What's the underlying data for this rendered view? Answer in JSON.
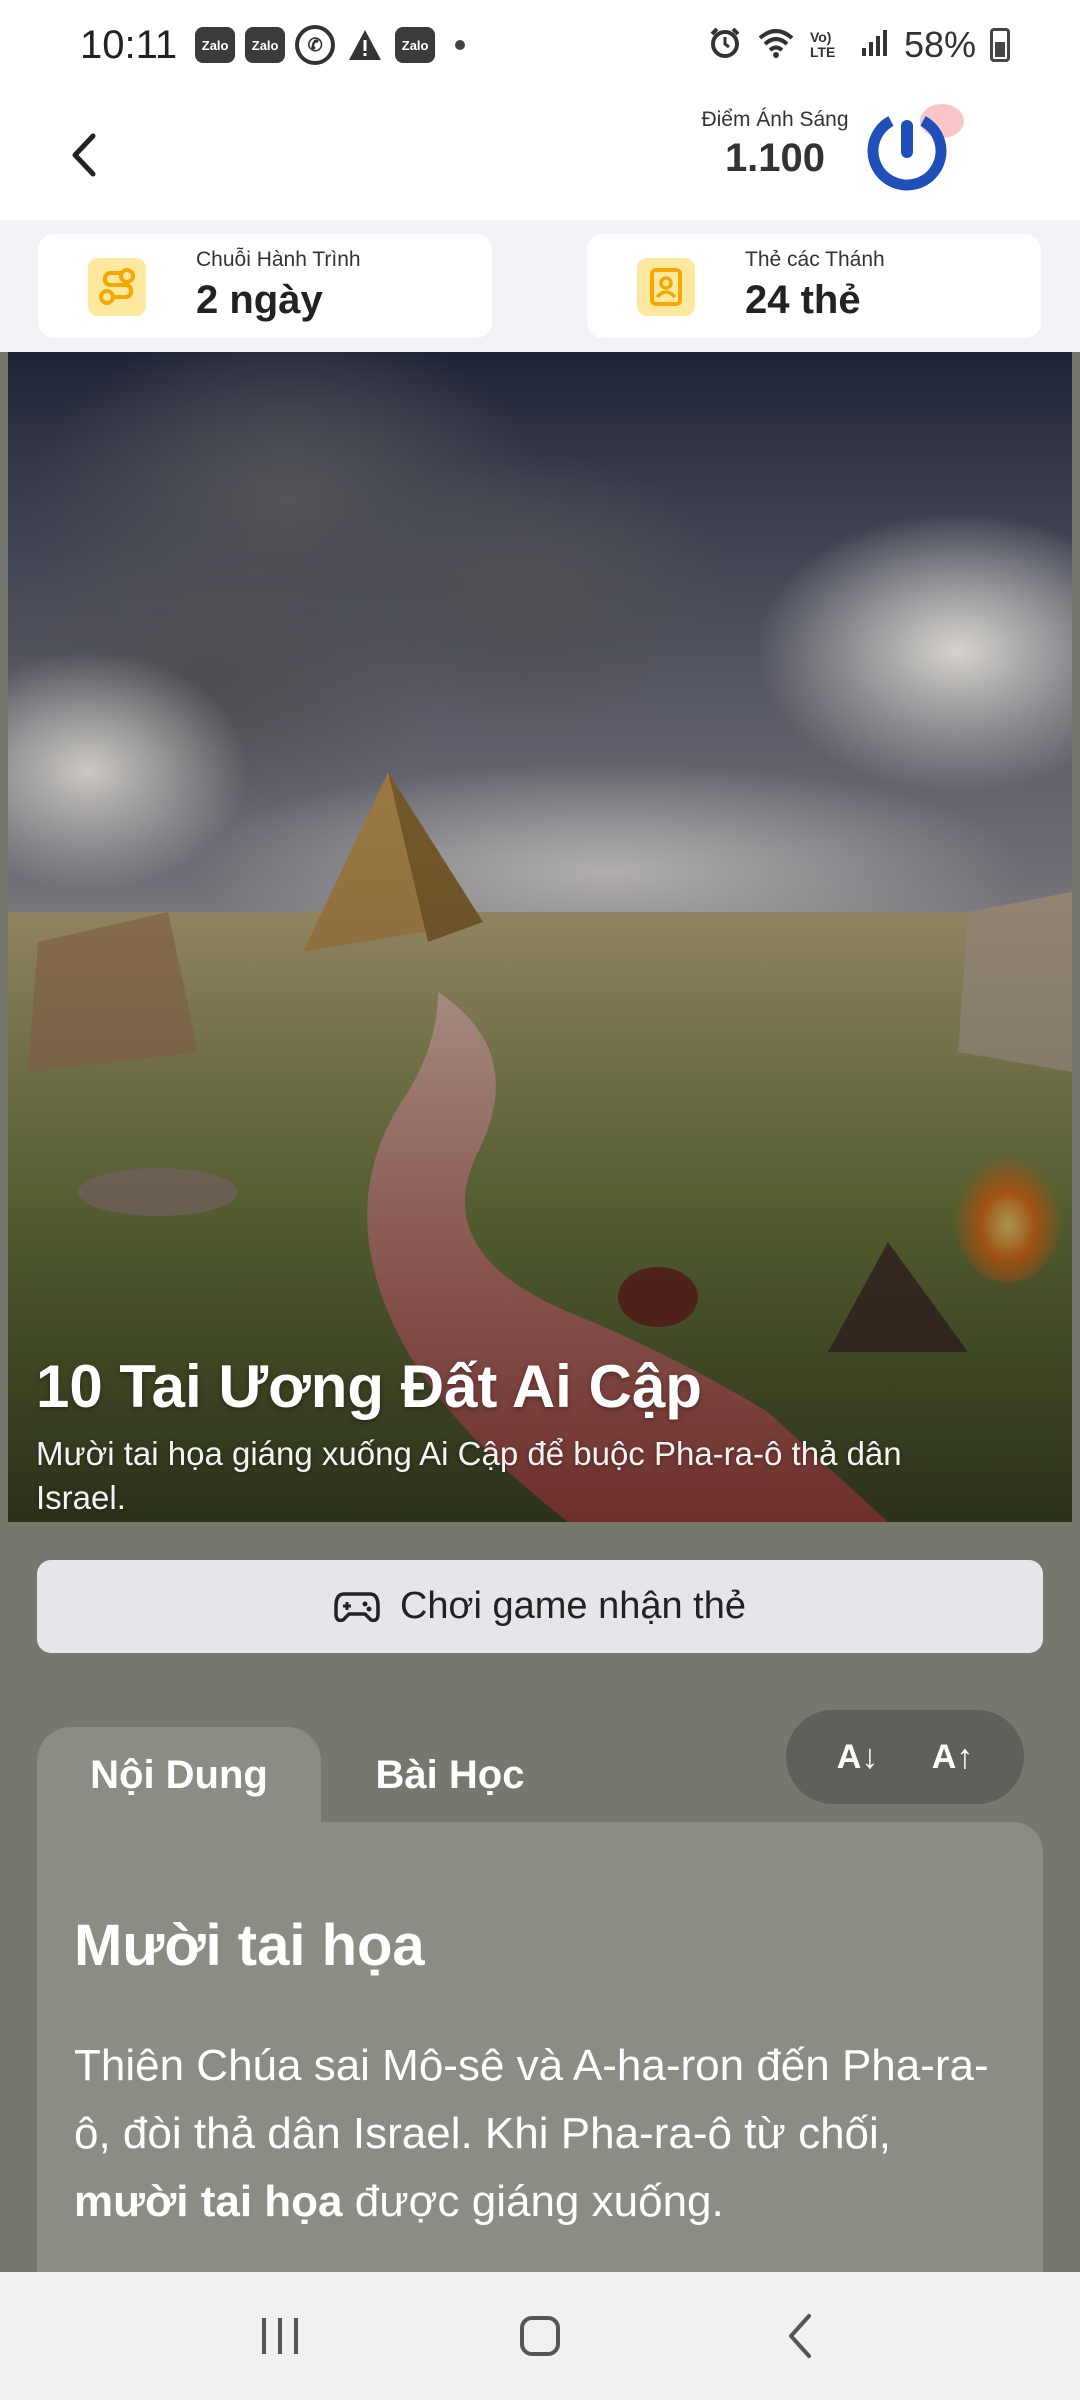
{
  "status": {
    "time": "10:11",
    "notifications": [
      "Zalo",
      "Zalo",
      "Zalo"
    ],
    "battery": "58%",
    "network": "Vo) LTE"
  },
  "header": {
    "points_label": "Điểm Ánh Sáng",
    "points_value": "1.100"
  },
  "stats": {
    "streak_label": "Chuỗi Hành Trình",
    "streak_value": "2 ngày",
    "cards_label": "Thẻ các Thánh",
    "cards_value": "24 thẻ"
  },
  "hero": {
    "title": "10 Tai Ương Đất Ai Cập",
    "subtitle": "Mười tai họa giáng xuống Ai Cập để buộc Pha-ra-ô thả dân Israel."
  },
  "play_button": "Chơi game nhận thẻ",
  "tabs": [
    {
      "label": "Nội Dung",
      "active": true
    },
    {
      "label": "Bài Học",
      "active": false
    }
  ],
  "font_controls": {
    "decrease": "A↓",
    "increase": "A↑"
  },
  "content": {
    "title": "Mười tai họa",
    "body_part1": "Thiên Chúa sai Mô-sê và A-ha-ron đến Pha-ra-ô, đòi thả dân Israel. Khi Pha-ra-ô từ chối, ",
    "body_bold": "mười tai họa",
    "body_part2": " được giáng xuống."
  },
  "colors": {
    "accent": "#1f4fb8",
    "background": "#76776d",
    "card": "#8b8c83",
    "icon_bg": "#fde8a0",
    "icon_fg": "#f5a800"
  }
}
